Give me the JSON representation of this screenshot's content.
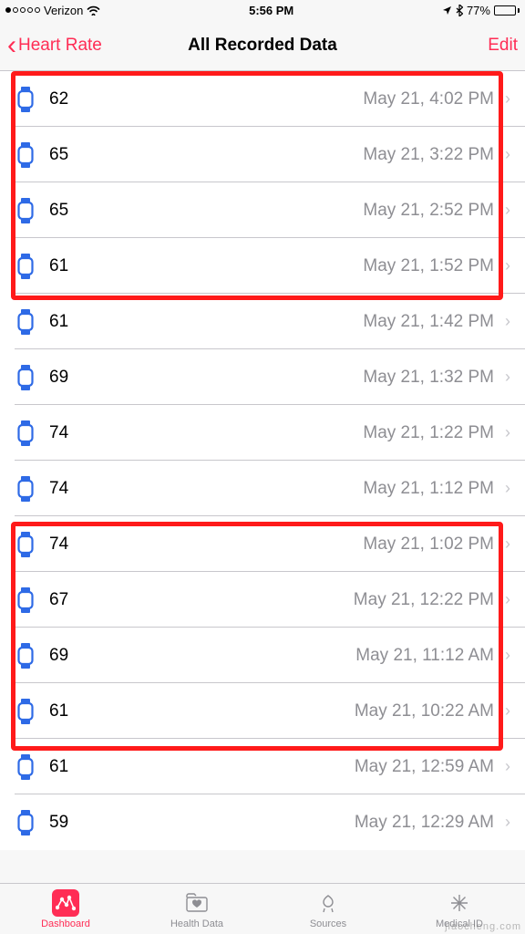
{
  "status": {
    "carrier": "Verizon",
    "time": "5:56 PM",
    "battery_pct": "77%"
  },
  "nav": {
    "back_label": "Heart Rate",
    "title": "All Recorded Data",
    "edit_label": "Edit"
  },
  "rows": [
    {
      "value": "62",
      "date": "May 21, 4:02 PM"
    },
    {
      "value": "65",
      "date": "May 21, 3:22 PM"
    },
    {
      "value": "65",
      "date": "May 21, 2:52 PM"
    },
    {
      "value": "61",
      "date": "May 21, 1:52 PM"
    },
    {
      "value": "61",
      "date": "May 21, 1:42 PM"
    },
    {
      "value": "69",
      "date": "May 21, 1:32 PM"
    },
    {
      "value": "74",
      "date": "May 21, 1:22 PM"
    },
    {
      "value": "74",
      "date": "May 21, 1:12 PM"
    },
    {
      "value": "74",
      "date": "May 21, 1:02 PM"
    },
    {
      "value": "67",
      "date": "May 21, 12:22 PM"
    },
    {
      "value": "69",
      "date": "May 21, 11:12 AM"
    },
    {
      "value": "61",
      "date": "May 21, 10:22 AM"
    },
    {
      "value": "61",
      "date": "May 21, 12:59 AM"
    },
    {
      "value": "59",
      "date": "May 21, 12:29 AM"
    }
  ],
  "tabs": {
    "dashboard": "Dashboard",
    "health_data": "Health Data",
    "sources": "Sources",
    "medical_id": "Medical ID"
  },
  "watermark": "jiaocheng.com"
}
